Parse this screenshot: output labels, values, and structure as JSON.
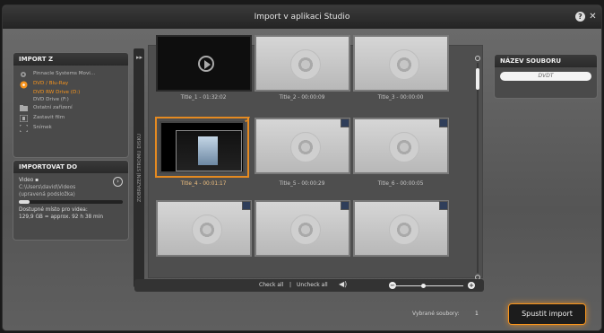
{
  "window": {
    "title": "Import v aplikaci Studio"
  },
  "import_from": {
    "header": "IMPORT Z",
    "sources": [
      {
        "label": "Pinnacle Systems Movi...",
        "icon": "gear-icon"
      },
      {
        "label": "DVD / Blu-Ray",
        "icon": "disc-icon",
        "active": true,
        "sub_items": [
          "DVD RW Drive (D:)",
          "DVD Drive (F:)"
        ]
      },
      {
        "label": "Ostatní zařízení",
        "icon": "folder-icon"
      },
      {
        "label": "Zastavit film",
        "icon": "film-icon"
      },
      {
        "label": "Snímek",
        "icon": "frame-icon"
      }
    ]
  },
  "import_to": {
    "header": "IMPORTOVAT DO",
    "video_label": "Video",
    "path": "C:\\Users\\david\\Videos",
    "note": "(upravená podsložka)",
    "free_space_label": "Dostupné místo pro videa:",
    "free_space_value": "129,9 GB = approx. 92 h 38 min"
  },
  "sidebar_tab": {
    "label": "ZOBRAZENÍ STROMU DISKU"
  },
  "thumbnails": [
    {
      "caption": "Title_1 - 01:32:02",
      "kind": "play"
    },
    {
      "caption": "Title_2 - 00:00:09",
      "kind": "disc"
    },
    {
      "caption": "Title_3 - 00:00:00",
      "kind": "disc"
    },
    {
      "caption": "Title_4 - 00:01:17",
      "kind": "selected"
    },
    {
      "caption": "Title_5 - 00:00:29",
      "kind": "disc"
    },
    {
      "caption": "Title_6 - 00:00:05",
      "kind": "disc"
    },
    {
      "caption": "",
      "kind": "disc"
    },
    {
      "caption": "",
      "kind": "disc"
    },
    {
      "caption": "",
      "kind": "disc"
    }
  ],
  "bottom_bar": {
    "check_all": "Check all",
    "separator": "|",
    "uncheck_all": "Uncheck all"
  },
  "filename": {
    "header": "NÁZEV SOUBORU",
    "value": "DVDT"
  },
  "footer": {
    "selected_label": "Vybrané soubory:",
    "selected_count": "1",
    "import_button": "Spustit import"
  }
}
